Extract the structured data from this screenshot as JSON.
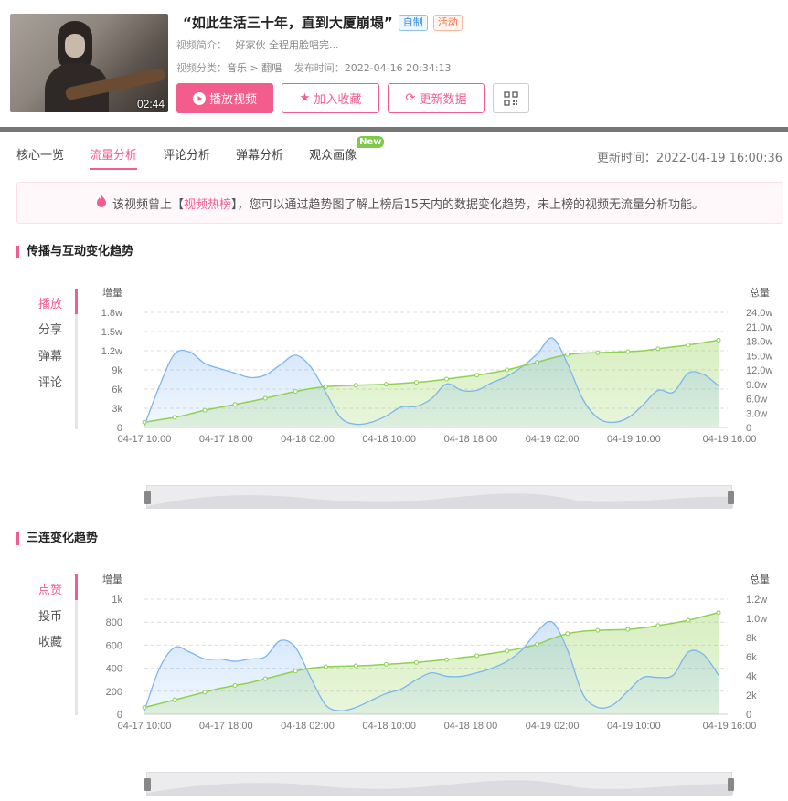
{
  "video": {
    "title": "“如此生活三十年，直到大厦崩塌”",
    "badge_self": "自制",
    "badge_event": "活动",
    "duration": "02:44",
    "intro_label": "视频简介：",
    "intro_value": "好家伙 全程用脸唱完...",
    "category_label": "视频分类：",
    "category_value": "音乐 > 翻唱",
    "publish_label": "发布时间：",
    "publish_value": "2022-04-16 20:34:13"
  },
  "buttons": {
    "play": "播放视频",
    "favorite": "加入收藏",
    "refresh": "更新数据"
  },
  "tabs": [
    {
      "label": "核心一览"
    },
    {
      "label": "流量分析"
    },
    {
      "label": "评论分析"
    },
    {
      "label": "弹幕分析"
    },
    {
      "label": "观众画像"
    }
  ],
  "new_badge": "New",
  "update_time": "更新时间：2022-04-19 16:00:36",
  "notice": {
    "prefix": "该视频曾上【",
    "hot": "视频热榜",
    "suffix": "】，您可以通过趋势图了解上榜后15天内的数据变化趋势，未上榜的视频无流量分析功能。"
  },
  "section1": {
    "title": "传播与互动变化趋势",
    "menu": [
      "播放",
      "分享",
      "弹幕",
      "评论"
    ]
  },
  "section2": {
    "title": "三连变化趋势",
    "menu": [
      "点赞",
      "投币",
      "收藏"
    ]
  },
  "colors": {
    "accent": "#f25d8e",
    "increment": "#7db5ef",
    "total": "#8fd14f"
  },
  "chart_data": [
    {
      "type": "area",
      "left_axis_label": "增量",
      "right_axis_label": "总量",
      "left_ticks": [
        "0",
        "3k",
        "6k",
        "9k",
        "1.2w",
        "1.5w",
        "1.8w"
      ],
      "right_ticks": [
        "0",
        "3.0w",
        "6.0w",
        "9.0w",
        "12.0w",
        "15.0w",
        "18.0w",
        "21.0w",
        "24.0w"
      ],
      "x_ticks": [
        "04-17 10:00",
        "04-17 18:00",
        "04-18 02:00",
        "04-18 10:00",
        "04-18 18:00",
        "04-19 02:00",
        "04-19 10:00",
        "04-19 16:00"
      ],
      "ylim_left": [
        0,
        18000
      ],
      "ylim_right": [
        0,
        240000
      ],
      "series": [
        {
          "axis": "left",
          "values": [
            300,
            6500,
            11500,
            11800,
            10000,
            9200,
            8500,
            7800,
            8200,
            9800,
            11300,
            9500,
            5500,
            1500,
            500,
            800,
            1800,
            3200,
            3300,
            4500,
            6800,
            5800,
            5800,
            7000,
            8000,
            9500,
            11500,
            14000,
            10000,
            4500,
            1500,
            800,
            1500,
            3500,
            5800,
            5500,
            8500,
            8300,
            6500
          ]
        },
        {
          "axis": "right",
          "values": [
            11000,
            16000,
            21000,
            28000,
            36000,
            42000,
            48000,
            54000,
            61000,
            68000,
            75000,
            81000,
            85000,
            87000,
            88000,
            89000,
            90000,
            92000,
            94000,
            97000,
            101000,
            105000,
            109000,
            114000,
            120000,
            128000,
            136000,
            145000,
            152000,
            155000,
            156000,
            157000,
            158000,
            160000,
            164000,
            168000,
            172000,
            177000,
            182000
          ]
        }
      ]
    },
    {
      "type": "area",
      "left_axis_label": "增量",
      "right_axis_label": "总量",
      "left_ticks": [
        "0",
        "200",
        "400",
        "600",
        "800",
        "1k"
      ],
      "right_ticks": [
        "0",
        "2k",
        "4k",
        "6k",
        "8k",
        "1.0w",
        "1.2w"
      ],
      "x_ticks": [
        "04-17 10:00",
        "04-17 18:00",
        "04-18 02:00",
        "04-18 10:00",
        "04-18 18:00",
        "04-19 02:00",
        "04-19 10:00",
        "04-19 16:00"
      ],
      "ylim_left": [
        0,
        1000
      ],
      "ylim_right": [
        0,
        12000
      ],
      "series": [
        {
          "axis": "left",
          "values": [
            30,
            400,
            580,
            540,
            480,
            480,
            460,
            480,
            500,
            640,
            580,
            320,
            80,
            30,
            60,
            120,
            180,
            220,
            300,
            360,
            330,
            330,
            360,
            400,
            460,
            560,
            720,
            800,
            560,
            180,
            60,
            80,
            200,
            320,
            320,
            340,
            540,
            520,
            340
          ]
        },
        {
          "axis": "right",
          "values": [
            700,
            1100,
            1500,
            1900,
            2300,
            2700,
            3000,
            3300,
            3700,
            4100,
            4500,
            4800,
            4950,
            5000,
            5050,
            5100,
            5200,
            5300,
            5400,
            5550,
            5700,
            5900,
            6100,
            6350,
            6600,
            6900,
            7300,
            7900,
            8400,
            8650,
            8750,
            8800,
            8850,
            9000,
            9250,
            9500,
            9800,
            10200,
            10600
          ]
        }
      ]
    }
  ]
}
